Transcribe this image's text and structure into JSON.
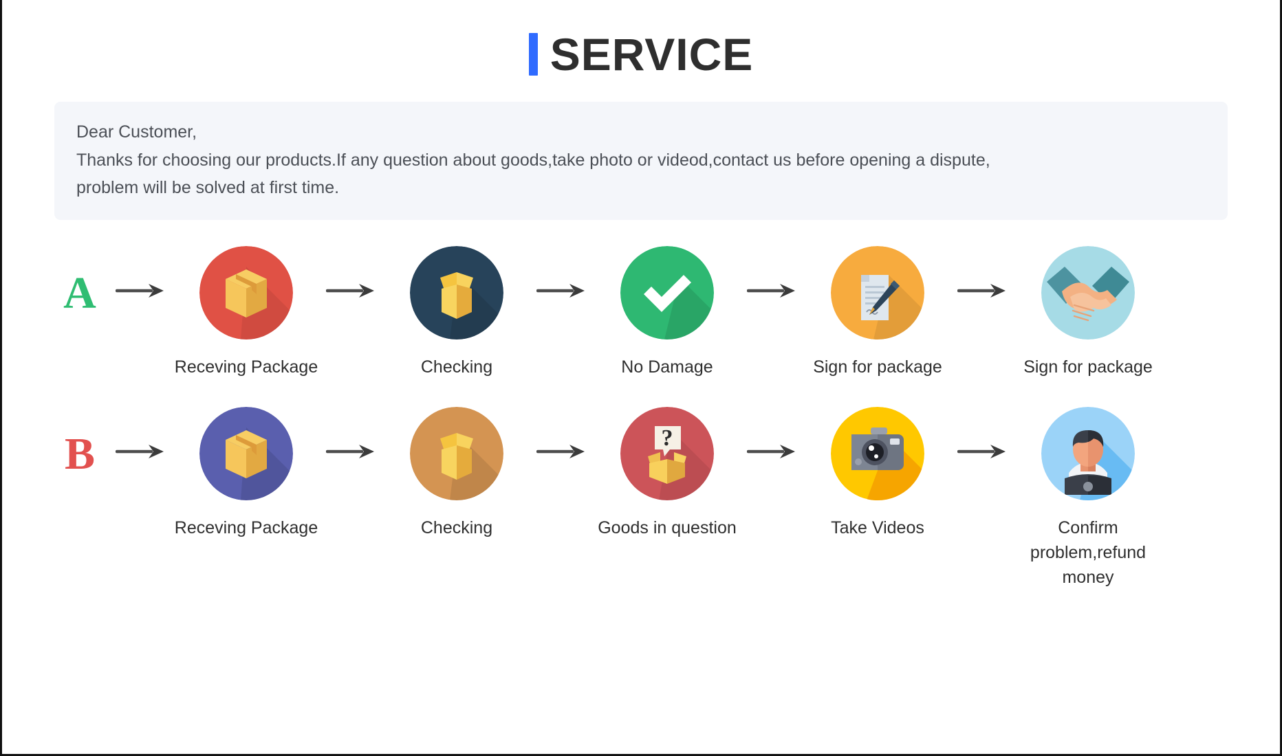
{
  "header": {
    "title": "SERVICE",
    "accent_color": "#2f6bff"
  },
  "notice": {
    "line1": "Dear Customer,",
    "line2": "Thanks for choosing our products.If any question about goods,take photo or videod,contact us before opening a dispute,",
    "line3": "problem will be solved at first time.",
    "background_color": "#f4f6fa"
  },
  "flows": [
    {
      "badge": "A",
      "badge_color": "#2fbd72",
      "steps": [
        {
          "label": "Receving Package",
          "icon": "closed-box-icon",
          "circle_color": "#e05145"
        },
        {
          "label": "Checking",
          "icon": "open-box-icon",
          "circle_color": "#27435a"
        },
        {
          "label": "No Damage",
          "icon": "check-mark-icon",
          "circle_color": "#2eb872"
        },
        {
          "label": "Sign for package",
          "icon": "document-pen-icon",
          "circle_color": "#f7ab3e"
        },
        {
          "label": "Sign for package",
          "icon": "handshake-icon",
          "circle_color": "#a6dbe6"
        }
      ]
    },
    {
      "badge": "B",
      "badge_color": "#e2514f",
      "steps": [
        {
          "label": "Receving Package",
          "icon": "closed-box-icon",
          "circle_color": "#5a5fae"
        },
        {
          "label": "Checking",
          "icon": "open-box-icon",
          "circle_color": "#d49452"
        },
        {
          "label": "Goods in question",
          "icon": "question-box-icon",
          "circle_color": "#cc5459"
        },
        {
          "label": "Take Videos",
          "icon": "camera-icon",
          "circle_color": "#ffc800"
        },
        {
          "label": "Confirm problem,refund money",
          "icon": "support-agent-icon",
          "circle_color": "#9bd3f8"
        }
      ]
    }
  ],
  "arrow": {
    "icon": "arrow-right-icon",
    "color": "#4d4d4d"
  }
}
